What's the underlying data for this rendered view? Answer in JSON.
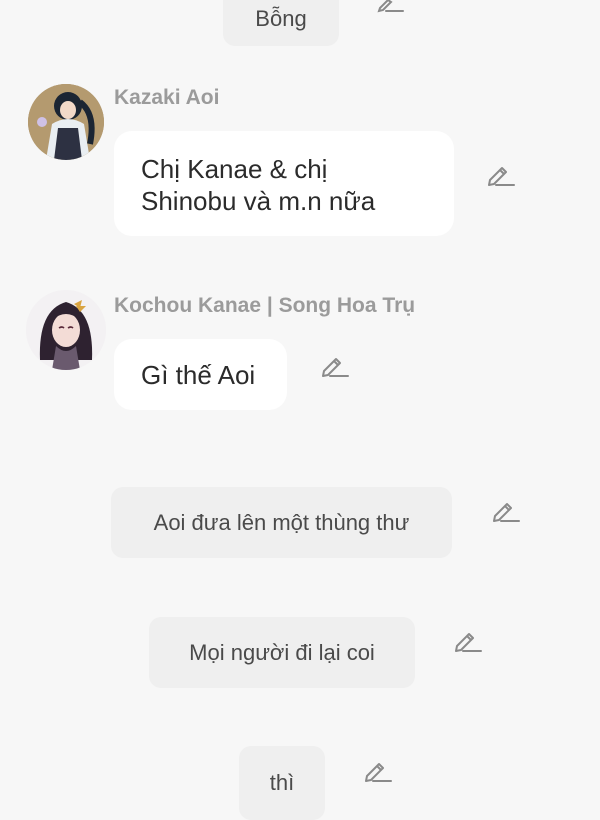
{
  "messages": {
    "top_narration": "Bỗng",
    "kazaki": {
      "sender": "Kazaki Aoi",
      "line1": "Chị Kanae & chị",
      "line2": "Shinobu và m.n nữa"
    },
    "kanae": {
      "sender": "Kochou Kanae | Song Hoa Trụ",
      "text": "Gì thế Aoi"
    },
    "narration1": "Aoi đưa lên một thùng thư",
    "narration2": "Mọi người đi lại coi",
    "narration3": "thì"
  },
  "icons": {
    "edit": "pencil-edit-icon",
    "avatar_aoi": "avatar-kazaki-aoi",
    "avatar_kanae": "avatar-kochou-kanae"
  },
  "colors": {
    "background": "#f7f7f7",
    "narration_bg": "#efefef",
    "bubble_bg": "#ffffff",
    "name_text": "#9b9b9b",
    "icon": "#8a8a8a"
  }
}
